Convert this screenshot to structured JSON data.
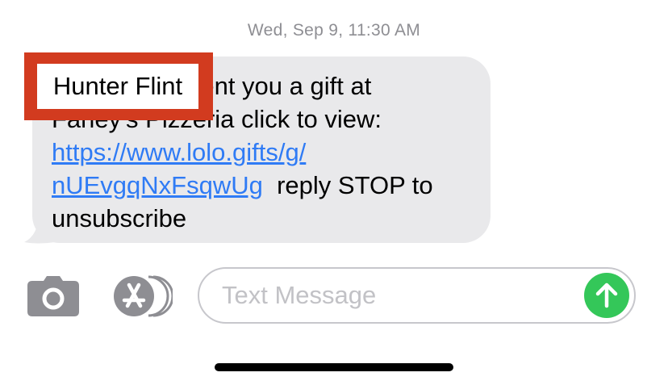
{
  "conversation": {
    "timestamp": "Wed, Sep 9, 11:30 AM"
  },
  "message": {
    "line1_rest": "sent you a gift at",
    "line2": "Farley's Pizzeria click to view:",
    "link_part1": "https://www.lolo.gifts/g/",
    "link_part2": "nUEvgqNxFsqwUg",
    "after_link": "  reply STOP to",
    "last_line": "unsubscribe",
    "link_color": "#2f7bf5",
    "bubble_color": "#e9e9eb"
  },
  "redaction": {
    "label": "Hunter Flint",
    "border_color": "#d23b1f"
  },
  "composer": {
    "camera_icon": "camera-icon",
    "apps_icon": "app-store-icon",
    "placeholder": "Text Message",
    "send_icon": "arrow-up-icon",
    "send_color": "#34c759"
  }
}
